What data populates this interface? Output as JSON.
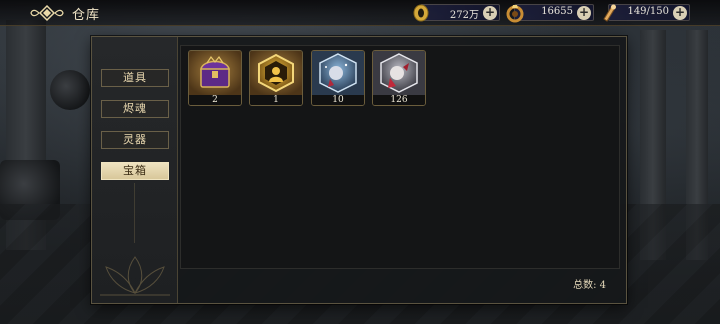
{
  "header": {
    "title": "仓库",
    "back_icon": "winged-back-icon"
  },
  "resources": [
    {
      "icon": "gold-coin-icon",
      "value": "272万",
      "color": "#e0b84a"
    },
    {
      "icon": "gem-ring-icon",
      "value": "16655",
      "color": "#d49a40"
    },
    {
      "icon": "stamina-scroll-icon",
      "value": "149/150",
      "color": "#e4b46a"
    }
  ],
  "tabs": [
    {
      "label": "道具",
      "active": false
    },
    {
      "label": "烬魂",
      "active": false
    },
    {
      "label": "灵器",
      "active": false
    },
    {
      "label": "宝箱",
      "active": true
    }
  ],
  "items": [
    {
      "name": "purple-chest",
      "count": "2"
    },
    {
      "name": "gold-hexagon-box",
      "count": "1"
    },
    {
      "name": "blue-crystal-pack",
      "count": "10"
    },
    {
      "name": "red-crystal-pack",
      "count": "126"
    }
  ],
  "footer": {
    "total_label": "总数: 4"
  }
}
